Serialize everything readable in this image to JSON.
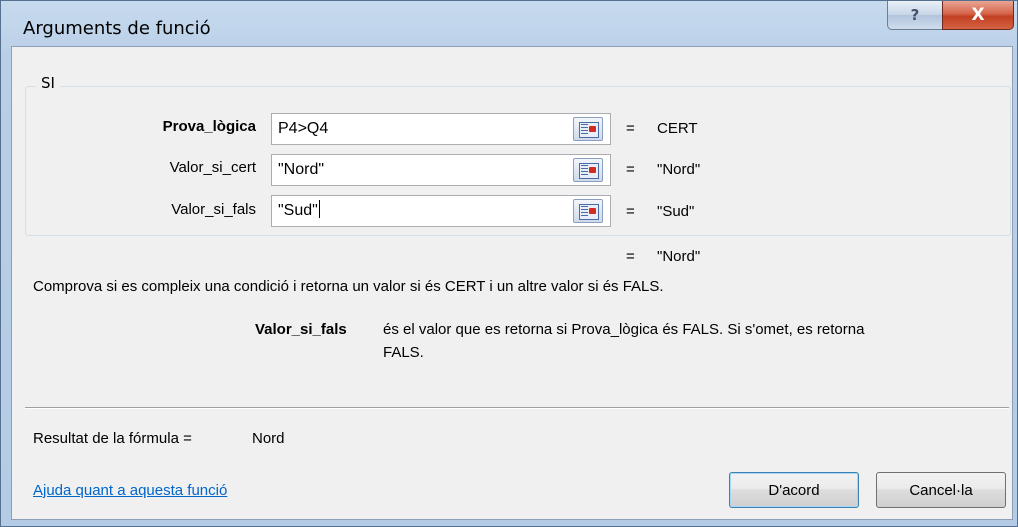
{
  "window": {
    "title": "Arguments de funció",
    "help_icon": "question-mark-icon",
    "help_label": "?",
    "close_icon": "close-x-icon",
    "close_label": "X"
  },
  "function": {
    "name": "SI",
    "args": [
      {
        "label": "Prova_lògica",
        "value": "P4>Q4",
        "result": "CERT",
        "bold": true
      },
      {
        "label": "Valor_si_cert",
        "value": "\"Nord\"",
        "result": "\"Nord\"",
        "bold": false
      },
      {
        "label": "Valor_si_fals",
        "value": "\"Sud\"",
        "result": "\"Sud\"",
        "bold": false
      }
    ],
    "equals": "=",
    "overall_result": "\"Nord\"",
    "description": "Comprova si es compleix una condició i retorna un valor si és CERT i un altre valor si és FALS.",
    "arg_help_name": "Valor_si_fals",
    "arg_help_text_line1": "és el valor que es retorna si Prova_lògica és FALS. Si s'omet, es retorna",
    "arg_help_text_line2": "FALS."
  },
  "footer": {
    "formula_result_label": "Resultat de la fórmula =",
    "formula_result_value": "Nord",
    "help_link": "Ajuda quant a aquesta funció",
    "ok_label": "D'acord",
    "cancel_label": "Cancel·la"
  },
  "colors": {
    "frame": "#b9cfe7",
    "link": "#0066cc",
    "close_button": "#c23f21",
    "collapse_icon_accent": "#d22b1f"
  }
}
